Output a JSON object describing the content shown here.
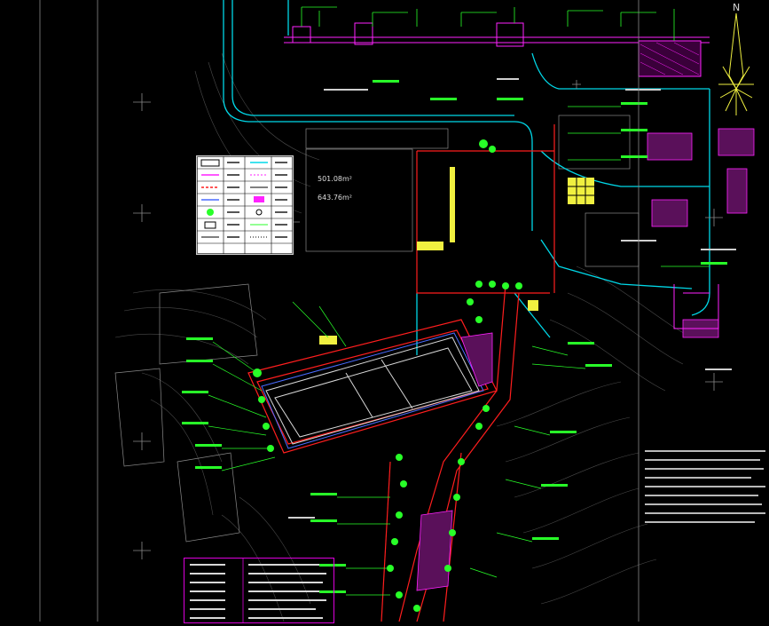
{
  "north_label": "N",
  "area_block": {
    "line1": "501.08m²",
    "line2": "643.76m²"
  },
  "colors": {
    "background": "#000000",
    "road_cyan": "#00d8e8",
    "boundary_red": "#ff1e1e",
    "green_leader": "#28ff28",
    "magenta_detail": "#ff22ff",
    "yellow_building": "#f0f040",
    "white_line": "#d8d8d8",
    "grey_contour": "#5a5a5a"
  },
  "icons": {
    "north_arrow": "compass-star-icon",
    "crosshair": "crosshair-icon",
    "tree": "tree-icon"
  }
}
